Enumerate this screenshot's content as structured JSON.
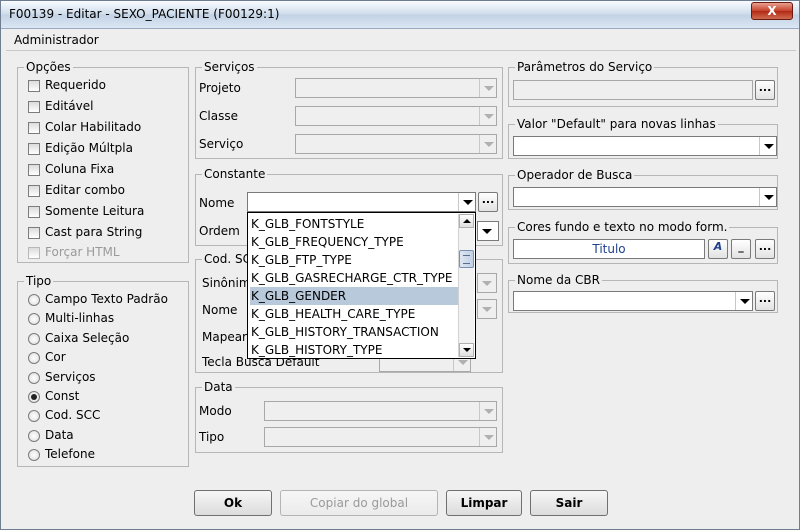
{
  "window": {
    "title": "F00139 - Editar - SEXO_PACIENTE (F00129:1)",
    "close_label": "X"
  },
  "header": {
    "label": "Administrador"
  },
  "opcoes": {
    "legend": "Opções",
    "items": [
      {
        "label": "Requerido"
      },
      {
        "label": "Editável"
      },
      {
        "label": "Colar Habilitado"
      },
      {
        "label": "Edição Múltpla"
      },
      {
        "label": "Coluna Fixa"
      },
      {
        "label": "Editar combo"
      },
      {
        "label": "Somente Leitura"
      },
      {
        "label": "Cast para String"
      },
      {
        "label": "Forçar HTML"
      }
    ]
  },
  "tipo": {
    "legend": "Tipo",
    "items": [
      {
        "label": "Campo Texto Padrão"
      },
      {
        "label": "Multi-linhas"
      },
      {
        "label": "Caixa Seleção"
      },
      {
        "label": "Cor"
      },
      {
        "label": "Serviços"
      },
      {
        "label": "Const"
      },
      {
        "label": "Cod. SCC"
      },
      {
        "label": "Data"
      },
      {
        "label": "Telefone"
      }
    ],
    "selected": "Const"
  },
  "servicos": {
    "legend": "Serviços",
    "projeto": "Projeto",
    "classe": "Classe",
    "servico": "Serviço"
  },
  "constante": {
    "legend": "Constante",
    "nome": "Nome",
    "ordem": "Ordem",
    "browse_label": "..."
  },
  "codscc": {
    "legend": "Cod. SCC",
    "sinonimo": "Sinônimo",
    "nome": "Nome",
    "mapear": "Mapear",
    "tecla": "Tecla Busca Default"
  },
  "data_group": {
    "legend": "Data",
    "modo": "Modo",
    "tipo": "Tipo"
  },
  "dropdown": {
    "items": [
      "K_GLB_FONTSTYLE",
      "K_GLB_FREQUENCY_TYPE",
      "K_GLB_FTP_TYPE",
      "K_GLB_GASRECHARGE_CTR_TYPE",
      "K_GLB_GENDER",
      "K_GLB_HEALTH_CARE_TYPE",
      "K_GLB_HISTORY_TRANSACTION",
      "K_GLB_HISTORY_TYPE"
    ],
    "selected_index": 4
  },
  "right": {
    "parametros": "Parâmetros do Serviço",
    "valor_default": "Valor \"Default\" para novas linhas",
    "operador": "Operador de Busca",
    "cores": "Cores fundo e texto no modo form.",
    "titulo": "Titulo",
    "font_btn": "A",
    "underscore_btn": "_",
    "ellipsis": "...",
    "nome_cbr": "Nome da CBR"
  },
  "buttons": {
    "ok": "Ok",
    "copiar": "Copiar do global",
    "limpar": "Limpar",
    "sair": "Sair"
  }
}
